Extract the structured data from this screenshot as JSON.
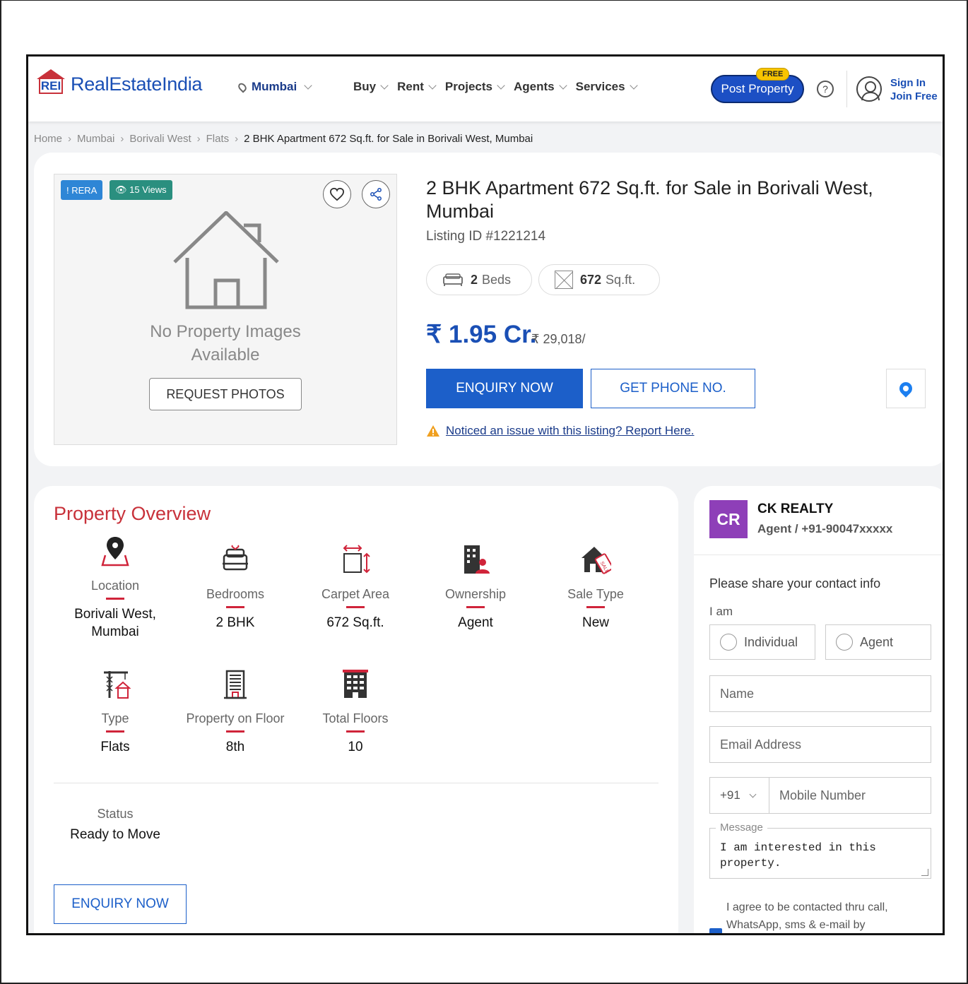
{
  "header": {
    "logo_mark": "REI",
    "logo_text": "RealEstateIndia",
    "city": "Mumbai",
    "nav": [
      "Buy",
      "Rent",
      "Projects",
      "Agents",
      "Services"
    ],
    "post_property": "Post Property",
    "free_badge": "FREE",
    "help": "?",
    "sign_in": "Sign In",
    "join_free": "Join Free"
  },
  "breadcrumb": {
    "items": [
      "Home",
      "Mumbai",
      "Borivali West",
      "Flats"
    ],
    "current": "2 BHK Apartment 672 Sq.ft. for Sale in Borivali West, Mumbai"
  },
  "gallery": {
    "rera_badge": "! RERA",
    "views_badge": "👁 15 Views",
    "no_images_line1": "No Property Images",
    "no_images_line2": "Available",
    "request_photos": "REQUEST PHOTOS"
  },
  "listing": {
    "title": "2 BHK Apartment 672 Sq.ft. for Sale in Borivali West, Mumbai",
    "listing_id": "Listing ID #1221214",
    "beds_value": "2",
    "beds_label": "Beds",
    "area_value": "672",
    "area_label": "Sq.ft.",
    "price": "₹ 1.95 Cr.",
    "price_per_sqft": "₹ 29,018/",
    "enquiry_now": "ENQUIRY NOW",
    "get_phone": "GET PHONE NO.",
    "report": "Noticed an issue with this listing? Report Here."
  },
  "overview": {
    "title": "Property Overview",
    "items": [
      {
        "label": "Location",
        "value": "Borivali West, Mumbai",
        "icon": "location-pin-icon"
      },
      {
        "label": "Bedrooms",
        "value": "2 BHK",
        "icon": "bed-icon"
      },
      {
        "label": "Carpet Area",
        "value": "672 Sq.ft.",
        "icon": "area-icon"
      },
      {
        "label": "Ownership",
        "value": "Agent",
        "icon": "ownership-icon"
      },
      {
        "label": "Sale Type",
        "value": "New",
        "icon": "sale-house-icon"
      },
      {
        "label": "Type",
        "value": "Flats",
        "icon": "construction-icon"
      },
      {
        "label": "Property on Floor",
        "value": "8th",
        "icon": "building-icon"
      },
      {
        "label": "Total Floors",
        "value": "10",
        "icon": "floors-icon"
      }
    ],
    "status_label": "Status",
    "status_value": "Ready to Move",
    "enquiry_now": "ENQUIRY NOW"
  },
  "agent": {
    "initials": "CR",
    "name": "CK REALTY",
    "sub": "Agent / +91-90047xxxxx",
    "form_title": "Please share your contact info",
    "i_am": "I am",
    "option_individual": "Individual",
    "option_agent": "Agent",
    "name_placeholder": "Name",
    "email_placeholder": "Email Address",
    "country_code": "+91",
    "mobile_placeholder": "Mobile Number",
    "message_legend": "Message",
    "message_text": "I am interested in this property.",
    "agree_text": "I agree to be contacted thru call, WhatsApp, sms & e-mail by"
  },
  "colors": {
    "brand_blue": "#1a4fb5",
    "brand_red": "#c8313a",
    "button_blue": "#1c5fc9",
    "avatar_purple": "#8e3fb8"
  }
}
